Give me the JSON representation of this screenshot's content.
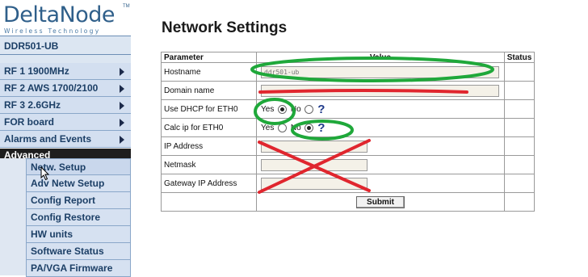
{
  "brand": {
    "name": "DeltaNode",
    "tm": "TM",
    "tagline": "Wireless Technology"
  },
  "device": {
    "model": "DDR501-UB"
  },
  "nav": {
    "items": [
      {
        "label": "RF 1 1900MHz"
      },
      {
        "label": "RF 2 AWS 1700/2100"
      },
      {
        "label": "RF 3 2.6GHz"
      },
      {
        "label": "FOR board"
      },
      {
        "label": "Alarms and Events"
      }
    ],
    "advanced_label": "Advanced",
    "sub_items": [
      {
        "label": "Netw. Setup"
      },
      {
        "label": "Adv Netw Setup"
      },
      {
        "label": "Config Report"
      },
      {
        "label": "Config Restore"
      },
      {
        "label": "HW units"
      },
      {
        "label": "Software Status"
      },
      {
        "label": "PA/VGA Firmware"
      }
    ]
  },
  "page": {
    "title": "Network Settings"
  },
  "table": {
    "headers": {
      "parameter": "Parameter",
      "value": "Value",
      "status": "Status"
    },
    "rows": {
      "hostname": {
        "label": "Hostname",
        "value": "ddr501-ub"
      },
      "domain": {
        "label": "Domain name",
        "value": ""
      },
      "dhcp": {
        "label": "Use DHCP for ETH0",
        "yes": "Yes",
        "no": "No",
        "help": "?"
      },
      "calc": {
        "label": "Calc ip for ETH0",
        "yes": "Yes",
        "no": "No",
        "help": "?"
      },
      "ip": {
        "label": "IP Address",
        "value": ""
      },
      "netmask": {
        "label": "Netmask",
        "value": ""
      },
      "gateway": {
        "label": "Gateway IP Address",
        "value": ""
      }
    },
    "submit_label": "Submit"
  },
  "colors": {
    "brand": "#2f5f8a",
    "nav_bg": "#d3dff0",
    "highlight_green": "#1fa83a",
    "strike_red": "#e0262e"
  }
}
